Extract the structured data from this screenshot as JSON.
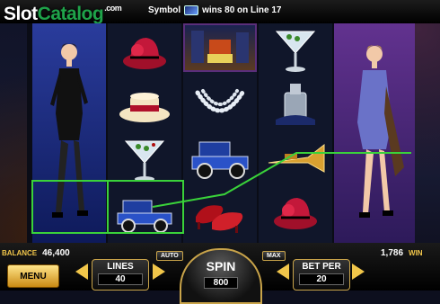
{
  "logo": {
    "part1": "Slot",
    "part2": "Catalog",
    "suffix": ".com"
  },
  "win_message": {
    "prefix": "Symbol",
    "suffix": "wins 80 on Line 17"
  },
  "balance": {
    "label": "BALANCE",
    "value": "46,400"
  },
  "win": {
    "label": "WIN",
    "value": "1,786"
  },
  "menu_label": "MENU",
  "lines": {
    "label": "LINES",
    "value": "40"
  },
  "spin": {
    "label": "SPIN",
    "value": "800"
  },
  "bet_per": {
    "label": "BET PER",
    "value": "20"
  },
  "auto_label": "AUTO",
  "max_label": "MAX",
  "colors": {
    "win_line": "#3ad23a",
    "gold": "#f1c64a"
  },
  "reels": [
    [
      "dancer-black-dress"
    ],
    [
      "red-hat",
      "boater-hat",
      "martini-glass",
      "blue-car"
    ],
    [
      "city-street",
      "pearl-necklace",
      "blue-car",
      "red-shoes"
    ],
    [
      "martini-glass",
      "lighter",
      "trumpet",
      "red-hat"
    ],
    [
      "dancer-blue-dress"
    ]
  ]
}
